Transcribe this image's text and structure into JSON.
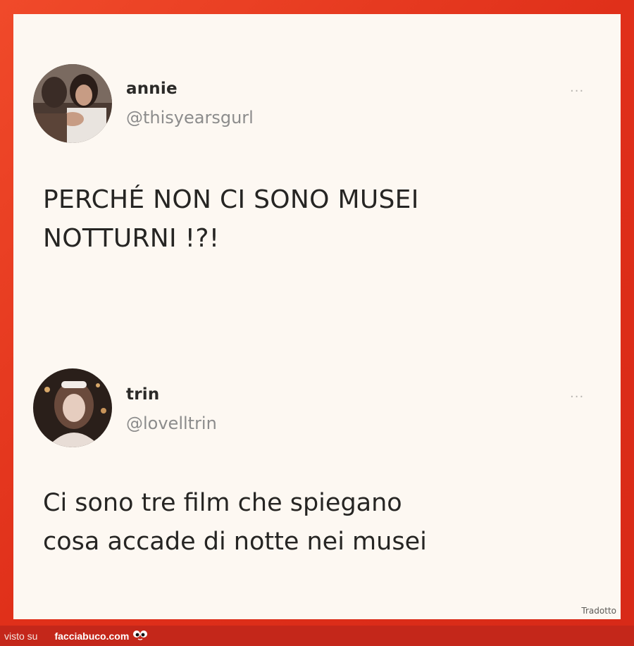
{
  "tweets": [
    {
      "name": "annie",
      "handle": "@thisyearsgurl",
      "text": "PERCHÉ NON CI SONO MUSEI\nNOTTURNI !?!",
      "more": "..."
    },
    {
      "name": "trin",
      "handle": "@lovelltrin",
      "text": "Ci sono tre film che spiegano\ncosa accade di notte nei musei",
      "more": "..."
    }
  ],
  "translated_label": "Tradotto",
  "footer": {
    "seen_on": "visto su",
    "site": "facciabuco.com",
    "logo_icon": "googly-eyes-icon"
  },
  "colors": {
    "frame": "#e2361e",
    "card": "#fdf8f2",
    "text": "#262523",
    "handle": "#8c8c8c"
  }
}
